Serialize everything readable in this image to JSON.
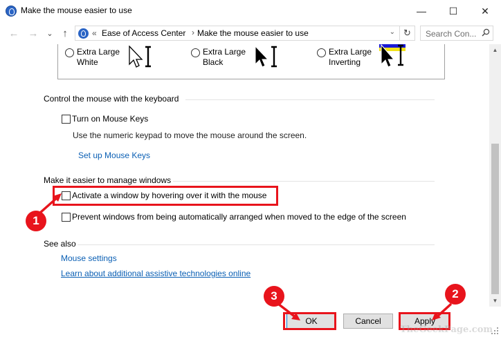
{
  "window": {
    "title": "Make the mouse easier to use",
    "minimize_glyph": "—",
    "maximize_glyph": "☐",
    "close_glyph": "✕"
  },
  "nav": {
    "back_glyph": "←",
    "forward_glyph": "→",
    "recent_glyph": "⌄",
    "up_glyph": "↑",
    "address_chevron": "«",
    "crumbs": [
      "Ease of Access Center",
      "Make the mouse easier to use"
    ],
    "crumb_sep": "›",
    "address_dropdown_glyph": "⌄",
    "refresh_glyph": "↻",
    "search_placeholder": "Search Con..."
  },
  "pointers": [
    {
      "line1": "Extra Large",
      "line2": "White",
      "underline_char": "W"
    },
    {
      "line1": "Extra Large",
      "line2": "Black",
      "underline_char": "a"
    },
    {
      "line1": "Extra Large",
      "line2": "Inverting",
      "underline_char": "I"
    }
  ],
  "keyboard_section": {
    "title": "Control the mouse with the keyboard",
    "mouse_keys_label": "Turn on Mouse Keys",
    "mouse_keys_desc": "Use the numeric keypad to move the mouse around the screen.",
    "setup_link": "Set up Mouse Keys"
  },
  "windows_section": {
    "title": "Make it easier to manage windows",
    "hover_label": "Activate a window by hovering over it with the mouse",
    "prevent_label": "Prevent windows from being automatically arranged when moved to the edge of the screen"
  },
  "see_also": {
    "title": "See also",
    "mouse_settings_link": "Mouse settings",
    "assistive_link": "Learn about additional assistive technologies online"
  },
  "buttons": {
    "ok": "OK",
    "cancel": "Cancel",
    "apply": "Apply"
  },
  "annotations": {
    "badge1": "1",
    "badge2": "2",
    "badge3": "3",
    "color": "#e8141c"
  },
  "watermark": "TheGeekPage.com",
  "scrollbar": {
    "up_glyph": "▲",
    "down_glyph": "▼"
  }
}
